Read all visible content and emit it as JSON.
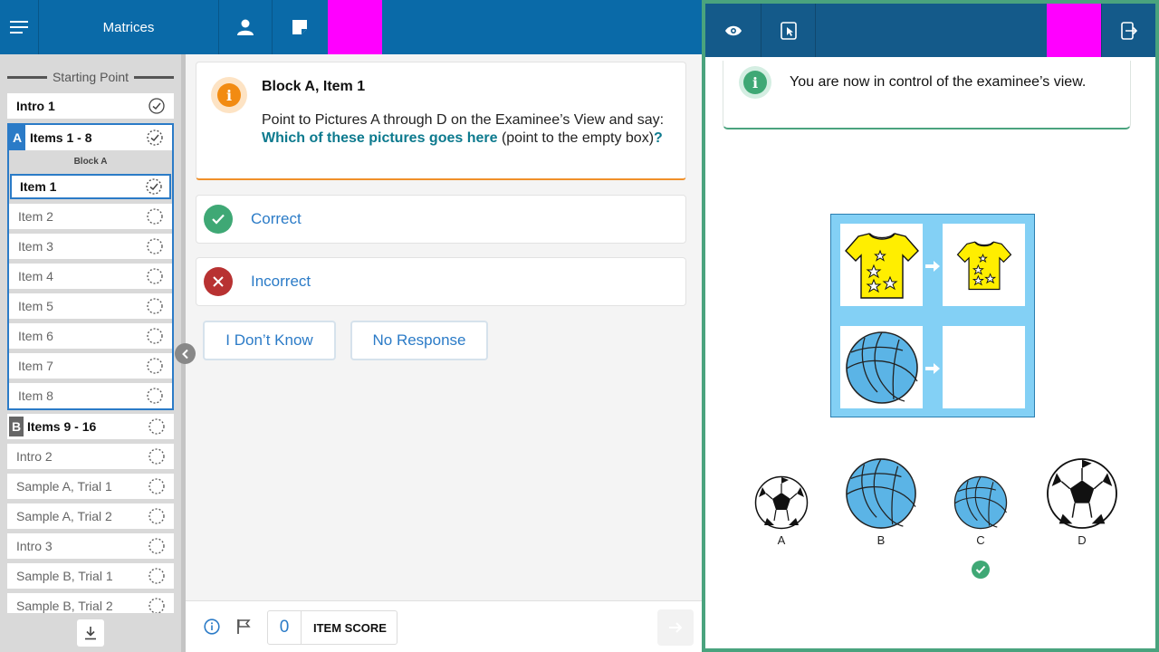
{
  "header": {
    "title": "Matrices"
  },
  "sidebar": {
    "starting_point": "Starting Point",
    "intro1": "Intro 1",
    "block_a": {
      "letter": "A",
      "title": "Items 1 - 8",
      "subtitle": "Block A",
      "items": [
        "Item 1",
        "Item 2",
        "Item 3",
        "Item 4",
        "Item 5",
        "Item 6",
        "Item 7",
        "Item 8"
      ]
    },
    "block_b": {
      "letter": "B",
      "title": "Items 9 - 16"
    },
    "rows_after": [
      "Intro 2",
      "Sample A, Trial 1",
      "Sample A, Trial 2",
      "Intro 3",
      "Sample B, Trial 1",
      "Sample B, Trial 2"
    ]
  },
  "instruction": {
    "title": "Block A, Item 1",
    "text_before": "Point to Pictures A through D on the Examinee’s View and say: ",
    "highlight": "Which of these pictures goes here",
    "text_after": " (point to the empty box)",
    "question_mark": "?"
  },
  "responses": {
    "correct": "Correct",
    "incorrect": "Incorrect",
    "dont_know": "I Don’t Know",
    "no_response": "No Response"
  },
  "footer": {
    "score_value": "0",
    "score_label": "ITEM SCORE"
  },
  "examinee": {
    "banner": "You are now in control of the examinee’s view.",
    "choices": [
      "A",
      "B",
      "C",
      "D"
    ],
    "selected_choice": "C"
  },
  "colors": {
    "topbar": "#0a6aa8",
    "topbar_right": "#145a8a",
    "accent_blue": "#2b7bc7",
    "highlight_teal": "#0d7a8e",
    "orange": "#f28b12",
    "green": "#3fa875",
    "red": "#b83232",
    "magenta": "#ff00ff"
  }
}
